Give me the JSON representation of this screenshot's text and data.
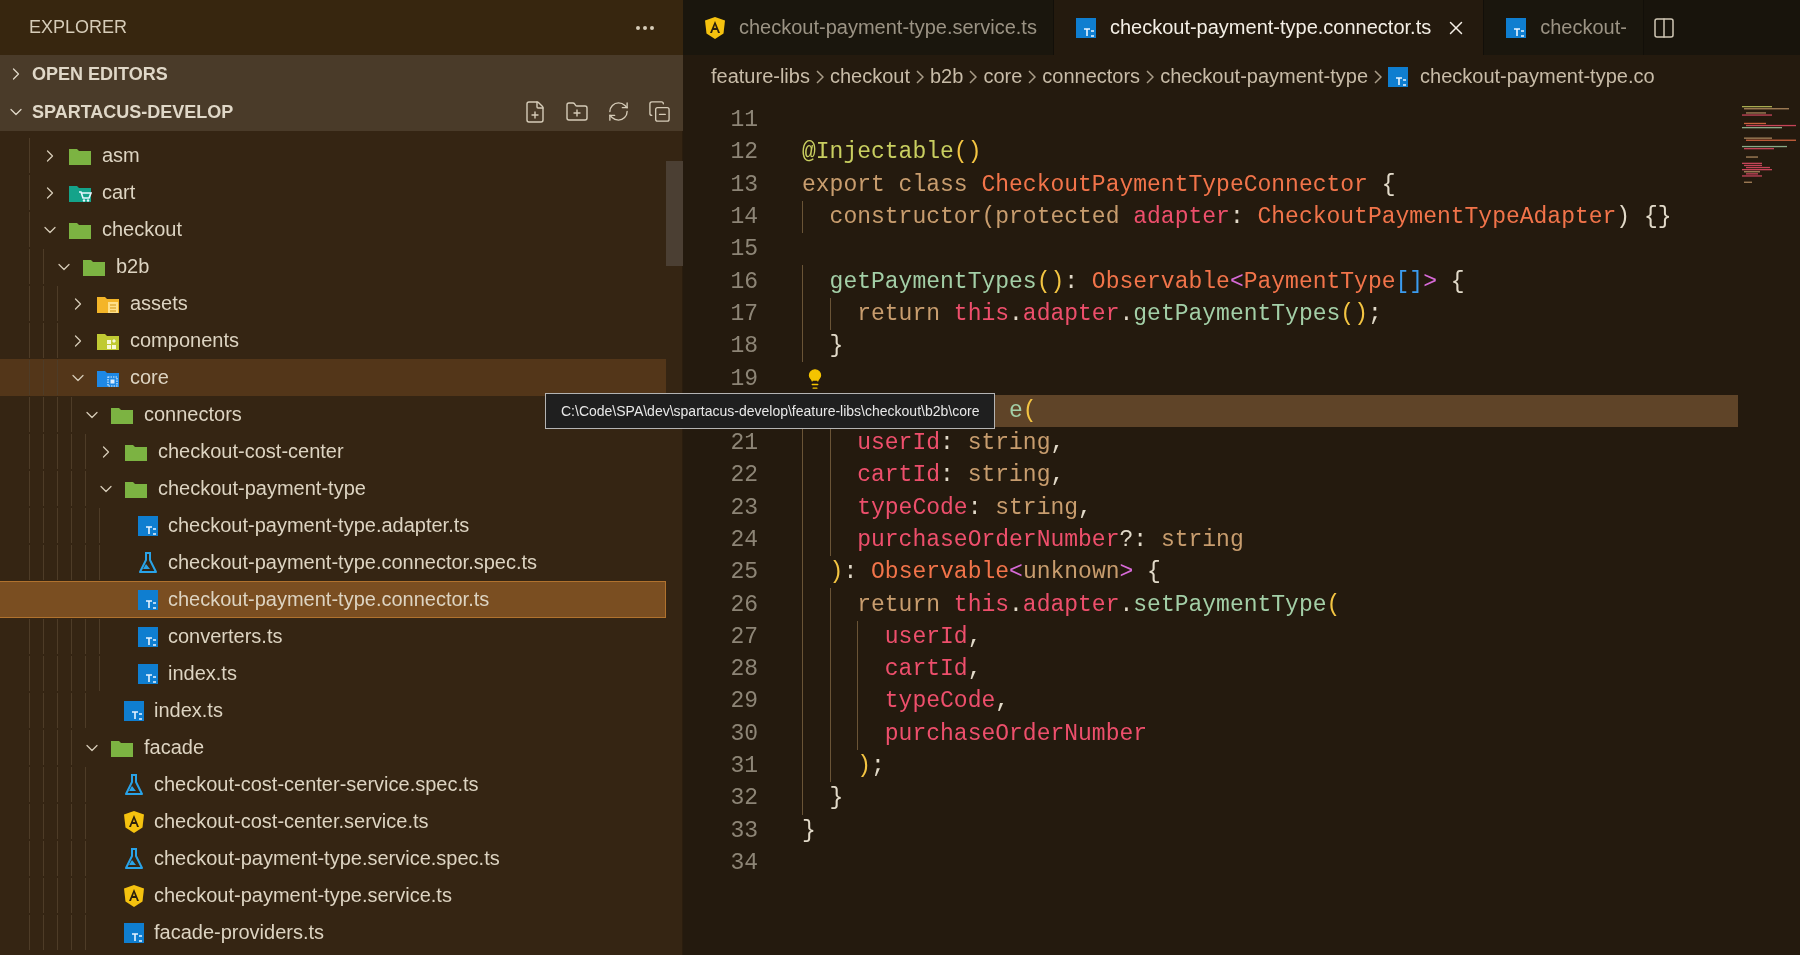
{
  "sidebar": {
    "title": "EXPLORER",
    "sections": [
      {
        "label": "OPEN EDITORS",
        "expanded": false
      },
      {
        "label": "SPARTACUS-DEVELOP",
        "expanded": true
      }
    ],
    "tree": [
      {
        "label": "asm",
        "kind": "folder",
        "expanded": false,
        "selected": false,
        "hovered": false
      },
      {
        "label": "cart",
        "kind": "cart-folder",
        "expanded": false,
        "selected": false,
        "hovered": false
      },
      {
        "label": "checkout",
        "kind": "folder",
        "expanded": true,
        "selected": false,
        "hovered": false,
        "children": [
          {
            "label": "b2b",
            "kind": "folder",
            "expanded": true,
            "selected": false,
            "hovered": false,
            "children": [
              {
                "label": "assets",
                "kind": "assets-folder",
                "expanded": false,
                "selected": false,
                "hovered": false
              },
              {
                "label": "components",
                "kind": "components-folder",
                "expanded": false,
                "selected": false,
                "hovered": false
              },
              {
                "label": "core",
                "kind": "core-folder",
                "expanded": true,
                "selected": false,
                "hovered": true,
                "children": [
                  {
                    "label": "connectors",
                    "kind": "folder",
                    "expanded": true,
                    "selected": false,
                    "hovered": false,
                    "children": [
                      {
                        "label": "checkout-cost-center",
                        "kind": "folder",
                        "expanded": false,
                        "selected": false,
                        "hovered": false
                      },
                      {
                        "label": "checkout-payment-type",
                        "kind": "folder",
                        "expanded": true,
                        "selected": false,
                        "hovered": false,
                        "children": [
                          {
                            "label": "checkout-payment-type.adapter.ts",
                            "kind": "ts-file",
                            "selected": false,
                            "hovered": false
                          },
                          {
                            "label": "checkout-payment-type.connector.spec.ts",
                            "kind": "spec-file",
                            "selected": false,
                            "hovered": false
                          },
                          {
                            "label": "checkout-payment-type.connector.ts",
                            "kind": "ts-file",
                            "selected": true,
                            "hovered": false
                          },
                          {
                            "label": "converters.ts",
                            "kind": "ts-file",
                            "selected": false,
                            "hovered": false
                          },
                          {
                            "label": "index.ts",
                            "kind": "ts-file",
                            "selected": false,
                            "hovered": false
                          }
                        ]
                      },
                      {
                        "label": "index.ts",
                        "kind": "ts-file",
                        "selected": false,
                        "hovered": false
                      }
                    ]
                  },
                  {
                    "label": "facade",
                    "kind": "folder",
                    "expanded": true,
                    "selected": false,
                    "hovered": false,
                    "children": [
                      {
                        "label": "checkout-cost-center-service.spec.ts",
                        "kind": "spec-file",
                        "selected": false,
                        "hovered": false
                      },
                      {
                        "label": "checkout-cost-center.service.ts",
                        "kind": "angular-file",
                        "selected": false,
                        "hovered": false
                      },
                      {
                        "label": "checkout-payment-type.service.spec.ts",
                        "kind": "spec-file",
                        "selected": false,
                        "hovered": false
                      },
                      {
                        "label": "checkout-payment-type.service.ts",
                        "kind": "angular-file",
                        "selected": false,
                        "hovered": false
                      },
                      {
                        "label": "facade-providers.ts",
                        "kind": "ts-file",
                        "selected": false,
                        "hovered": false
                      }
                    ]
                  }
                ]
              }
            ]
          }
        ]
      }
    ]
  },
  "tabs": [
    {
      "label": "checkout-payment-type.service.ts",
      "kind": "angular-file",
      "selected": false
    },
    {
      "label": "checkout-payment-type.connector.ts",
      "kind": "ts-file",
      "selected": true
    },
    {
      "label": "checkout-",
      "kind": "ts-file",
      "selected": false
    }
  ],
  "breadcrumbs": [
    {
      "label": "feature-libs",
      "kind": "folder"
    },
    {
      "label": "checkout",
      "kind": "folder"
    },
    {
      "label": "b2b",
      "kind": "folder"
    },
    {
      "label": "core",
      "kind": "folder"
    },
    {
      "label": "connectors",
      "kind": "folder"
    },
    {
      "label": "checkout-payment-type",
      "kind": "folder"
    },
    {
      "label": "checkout-payment-type.co",
      "kind": "ts-file"
    }
  ],
  "editor": {
    "lines": [
      {
        "number": "11",
        "current": false,
        "lightbulb": false
      },
      {
        "number": "12",
        "current": false,
        "lightbulb": false,
        "tokens": [
          {
            "text": "@Injectable",
            "kind": "decorator"
          },
          {
            "text": "()",
            "kind": "bracket"
          }
        ]
      },
      {
        "number": "13",
        "current": false,
        "lightbulb": false,
        "tokens": [
          {
            "text": "export class ",
            "kind": "keyword"
          },
          {
            "text": "CheckoutPaymentTypeConnector",
            "kind": "type"
          },
          {
            "text": " {",
            "kind": "punct"
          }
        ]
      },
      {
        "number": "14",
        "current": false,
        "lightbulb": false,
        "tokens": [
          {
            "text": "  constructor(protected ",
            "kind": "keyword"
          },
          {
            "text": "adapter",
            "kind": "variable"
          },
          {
            "text": ": ",
            "kind": "punct"
          },
          {
            "text": "CheckoutPaymentTypeAdapter",
            "kind": "type"
          },
          {
            "text": ") {}",
            "kind": "punct"
          }
        ]
      },
      {
        "number": "15",
        "current": false,
        "lightbulb": false
      },
      {
        "number": "16",
        "current": false,
        "lightbulb": false,
        "tokens": [
          {
            "text": "  getPaymentTypes",
            "kind": "function"
          },
          {
            "text": "()",
            "kind": "bracket"
          },
          {
            "text": ": ",
            "kind": "punct"
          },
          {
            "text": "Observable",
            "kind": "type"
          },
          {
            "text": "<",
            "kind": "bracket2"
          },
          {
            "text": "PaymentType",
            "kind": "type"
          },
          {
            "text": "[]",
            "kind": "bracket3"
          },
          {
            "text": ">",
            "kind": "bracket2"
          },
          {
            "text": " {",
            "kind": "punct"
          }
        ]
      },
      {
        "number": "17",
        "current": false,
        "lightbulb": false,
        "tokens": [
          {
            "text": "    return ",
            "kind": "keyword"
          },
          {
            "text": "this",
            "kind": "variable"
          },
          {
            "text": ".",
            "kind": "punct"
          },
          {
            "text": "adapter",
            "kind": "variable"
          },
          {
            "text": ".",
            "kind": "punct"
          },
          {
            "text": "getPaymentTypes",
            "kind": "function"
          },
          {
            "text": "()",
            "kind": "bracket"
          },
          {
            "text": ";",
            "kind": "punct"
          }
        ]
      },
      {
        "number": "18",
        "current": false,
        "lightbulb": false,
        "tokens": [
          {
            "text": "  }",
            "kind": "punct"
          }
        ]
      },
      {
        "number": "19",
        "current": false,
        "lightbulb": true
      },
      {
        "current": true,
        "lightbulb": false,
        "tokens": [
          {
            "text": "               e",
            "kind": "function"
          },
          {
            "text": "(",
            "kind": "bracket"
          }
        ]
      },
      {
        "number": "21",
        "current": false,
        "lightbulb": false,
        "tokens": [
          {
            "text": "    userId",
            "kind": "variable"
          },
          {
            "text": ": ",
            "kind": "punct"
          },
          {
            "text": "string",
            "kind": "keyword"
          },
          {
            "text": ",",
            "kind": "punct"
          }
        ]
      },
      {
        "number": "22",
        "current": false,
        "lightbulb": false,
        "tokens": [
          {
            "text": "    cartId",
            "kind": "variable"
          },
          {
            "text": ": ",
            "kind": "punct"
          },
          {
            "text": "string",
            "kind": "keyword"
          },
          {
            "text": ",",
            "kind": "punct"
          }
        ]
      },
      {
        "number": "23",
        "current": false,
        "lightbulb": false,
        "tokens": [
          {
            "text": "    typeCode",
            "kind": "variable"
          },
          {
            "text": ": ",
            "kind": "punct"
          },
          {
            "text": "string",
            "kind": "keyword"
          },
          {
            "text": ",",
            "kind": "punct"
          }
        ]
      },
      {
        "number": "24",
        "current": false,
        "lightbulb": false,
        "tokens": [
          {
            "text": "    purchaseOrderNumber",
            "kind": "variable"
          },
          {
            "text": "?: ",
            "kind": "punct"
          },
          {
            "text": "string",
            "kind": "keyword"
          }
        ]
      },
      {
        "number": "25",
        "current": false,
        "lightbulb": false,
        "tokens": [
          {
            "text": "  )",
            "kind": "bracket"
          },
          {
            "text": ": ",
            "kind": "punct"
          },
          {
            "text": "Observable",
            "kind": "type"
          },
          {
            "text": "<",
            "kind": "bracket2"
          },
          {
            "text": "unknown",
            "kind": "keyword"
          },
          {
            "text": ">",
            "kind": "bracket2"
          },
          {
            "text": " {",
            "kind": "punct"
          }
        ]
      },
      {
        "number": "26",
        "current": false,
        "lightbulb": false,
        "tokens": [
          {
            "text": "    return ",
            "kind": "keyword"
          },
          {
            "text": "this",
            "kind": "variable"
          },
          {
            "text": ".",
            "kind": "punct"
          },
          {
            "text": "adapter",
            "kind": "variable"
          },
          {
            "text": ".",
            "kind": "punct"
          },
          {
            "text": "setPaymentType",
            "kind": "function"
          },
          {
            "text": "(",
            "kind": "bracket"
          }
        ]
      },
      {
        "number": "27",
        "current": false,
        "lightbulb": false,
        "tokens": [
          {
            "text": "      userId",
            "kind": "variable"
          },
          {
            "text": ",",
            "kind": "punct"
          }
        ]
      },
      {
        "number": "28",
        "current": false,
        "lightbulb": false,
        "tokens": [
          {
            "text": "      cartId",
            "kind": "variable"
          },
          {
            "text": ",",
            "kind": "punct"
          }
        ]
      },
      {
        "number": "29",
        "current": false,
        "lightbulb": false,
        "tokens": [
          {
            "text": "      typeCode",
            "kind": "variable"
          },
          {
            "text": ",",
            "kind": "punct"
          }
        ]
      },
      {
        "number": "30",
        "current": false,
        "lightbulb": false,
        "tokens": [
          {
            "text": "      purchaseOrderNumber",
            "kind": "variable"
          }
        ]
      },
      {
        "number": "31",
        "current": false,
        "lightbulb": false,
        "tokens": [
          {
            "text": "    )",
            "kind": "bracket"
          },
          {
            "text": ";",
            "kind": "punct"
          }
        ]
      },
      {
        "number": "32",
        "current": false,
        "lightbulb": false,
        "tokens": [
          {
            "text": "  }",
            "kind": "punct"
          }
        ]
      },
      {
        "number": "33",
        "current": false,
        "lightbulb": false,
        "tokens": [
          {
            "text": "}",
            "kind": "punct"
          }
        ]
      },
      {
        "number": "34",
        "current": false,
        "lightbulb": false
      }
    ]
  },
  "tooltip": {
    "text": "C:\\Code\\SPA\\dev\\spartacus-develop\\feature-libs\\checkout\\b2b\\core"
  }
}
